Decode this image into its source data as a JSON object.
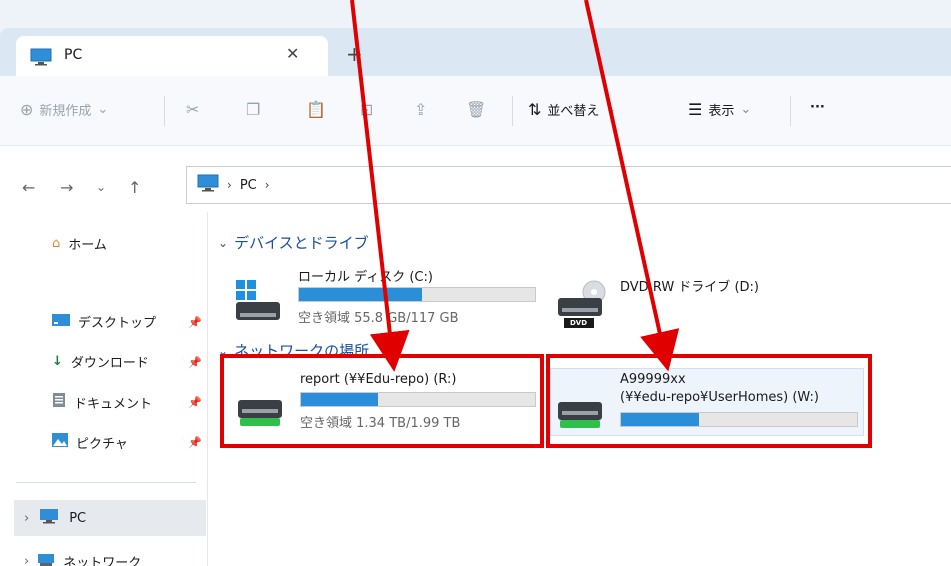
{
  "window": {
    "tab_title": "PC",
    "close_glyph": "✕",
    "new_tab_glyph": "+"
  },
  "commandbar": {
    "new_label": "新規作成",
    "sort_label": "並べ替え",
    "view_label": "表示",
    "more_label": "···"
  },
  "address": {
    "path": [
      "PC"
    ]
  },
  "sidebar": {
    "home": "ホーム",
    "items": [
      {
        "label": "デスクトップ",
        "icon": "desktop-icon"
      },
      {
        "label": "ダウンロード",
        "icon": "download-icon"
      },
      {
        "label": "ドキュメント",
        "icon": "document-icon"
      },
      {
        "label": "ピクチャ",
        "icon": "picture-icon"
      }
    ],
    "pc": "PC",
    "network": "ネットワーク"
  },
  "main": {
    "devices_header": "デバイスとドライブ",
    "network_header": "ネットワークの場所",
    "local_disk": {
      "name": "ローカル ディスク (C:)",
      "free": "空き領域 55.8 GB/117 GB",
      "used_fraction": 0.52
    },
    "dvd": {
      "name": "DVD RW ドライブ (D:)",
      "label": "DVD"
    },
    "report": {
      "name": "report (¥¥Edu-repo) (R:)",
      "free": "空き領域 1.34 TB/1.99 TB",
      "used_fraction": 0.33
    },
    "user": {
      "name_line1": "A99999xx",
      "name_line2": "(¥¥edu-repo¥UserHomes) (W:)",
      "used_fraction": 0.33
    }
  },
  "colors": {
    "accent": "#2a8fd8",
    "highlight": "#e00000"
  }
}
